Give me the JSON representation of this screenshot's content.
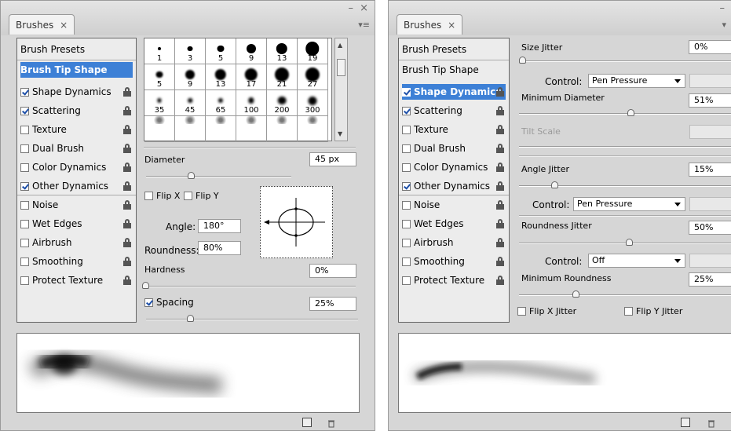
{
  "left_panel": {
    "tab_label": "Brushes",
    "tab_close": "×",
    "window_controls": "– ×",
    "menu_icon": "▾≡",
    "list": {
      "header": "Brush Presets",
      "items": [
        {
          "label": "Brush Tip Shape",
          "selected": true,
          "checkbox": false,
          "checked": false,
          "lock": false
        },
        {
          "label": "Shape Dynamics",
          "checked": true
        },
        {
          "label": "Scattering",
          "checked": true
        },
        {
          "label": "Texture",
          "checked": false
        },
        {
          "label": "Dual Brush",
          "checked": false
        },
        {
          "label": "Color Dynamics",
          "checked": false
        },
        {
          "label": "Other Dynamics",
          "checked": true
        },
        {
          "label": "Noise",
          "checked": false
        },
        {
          "label": "Wet Edges",
          "checked": false
        },
        {
          "label": "Airbrush",
          "checked": false
        },
        {
          "label": "Smoothing",
          "checked": false
        },
        {
          "label": "Protect Texture",
          "checked": false
        }
      ]
    },
    "brush_grid": {
      "sizes": [
        "1",
        "3",
        "5",
        "9",
        "13",
        "19",
        "5",
        "9",
        "13",
        "17",
        "21",
        "27",
        "35",
        "45",
        "65",
        "100",
        "200",
        "300"
      ]
    },
    "diameter": {
      "label": "Diameter",
      "value": "45 px",
      "slider": 0.3
    },
    "flip_x": {
      "label": "Flip X",
      "checked": false
    },
    "flip_y": {
      "label": "Flip Y",
      "checked": false
    },
    "angle": {
      "label": "Angle:",
      "value": "180°"
    },
    "roundness": {
      "label": "Roundness:",
      "value": "80%"
    },
    "hardness": {
      "label": "Hardness",
      "value": "0%",
      "slider": 0.0
    },
    "spacing": {
      "label": "Spacing",
      "value": "25%",
      "checked": true,
      "slider": 0.2
    }
  },
  "right_panel": {
    "tab_label": "Brushes",
    "tab_close": "×",
    "window_controls": "–",
    "menu_icon": "▾",
    "list": {
      "header": "Brush Presets",
      "items": [
        {
          "label": "Brush Tip Shape",
          "selected": false,
          "checkbox": false,
          "lock": false
        },
        {
          "label": "Shape Dynamics",
          "checked": true,
          "selected": true
        },
        {
          "label": "Scattering",
          "checked": true
        },
        {
          "label": "Texture",
          "checked": false
        },
        {
          "label": "Dual Brush",
          "checked": false
        },
        {
          "label": "Color Dynamics",
          "checked": false
        },
        {
          "label": "Other Dynamics",
          "checked": true
        },
        {
          "label": "Noise",
          "checked": false
        },
        {
          "label": "Wet Edges",
          "checked": false
        },
        {
          "label": "Airbrush",
          "checked": false
        },
        {
          "label": "Smoothing",
          "checked": false
        },
        {
          "label": "Protect Texture",
          "checked": false
        }
      ]
    },
    "size_jitter": {
      "label": "Size Jitter",
      "value": "0%",
      "slider": 0.0
    },
    "control1": {
      "label": "Control:",
      "value": "Pen Pressure"
    },
    "minimum_diameter": {
      "label": "Minimum Diameter",
      "value": "51%",
      "slider": 0.51
    },
    "tilt_scale": {
      "label": "Tilt Scale",
      "disabled": true
    },
    "angle_jitter": {
      "label": "Angle Jitter",
      "value": "15%",
      "slider": 0.15
    },
    "control2": {
      "label": "Control:",
      "value": "Pen Pressure"
    },
    "roundness_jitter": {
      "label": "Roundness Jitter",
      "value": "50%",
      "slider": 0.5
    },
    "control3": {
      "label": "Control:",
      "value": "Off"
    },
    "minimum_roundness": {
      "label": "Minimum Roundness",
      "value": "25%",
      "slider": 0.25
    },
    "flip_x_jitter": {
      "label": "Flip X Jitter",
      "checked": false
    },
    "flip_y_jitter": {
      "label": "Flip Y Jitter",
      "checked": false
    }
  }
}
